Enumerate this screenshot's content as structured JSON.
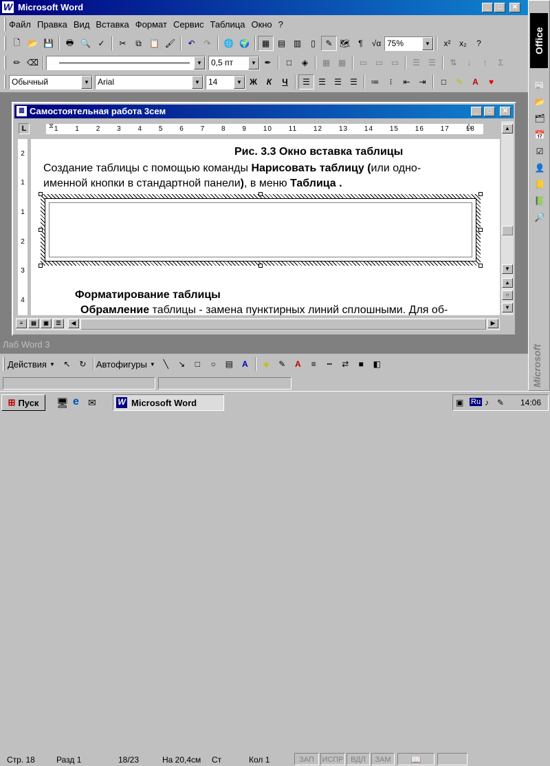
{
  "app": {
    "title": "Microsoft Word",
    "min": "_",
    "max": "□",
    "close": "✕"
  },
  "menu": [
    "Файл",
    "Правка",
    "Вид",
    "Вставка",
    "Формат",
    "Сервис",
    "Таблица",
    "Окно",
    "?"
  ],
  "toolbar": {
    "zoom": "75%",
    "border_width": "0,5 пт",
    "style": "Обычный",
    "font": "Arial",
    "size": "14",
    "bold": "Ж",
    "italic": "К",
    "underline": "Ч"
  },
  "doc": {
    "title": "Самостоятельная работа 3сем",
    "ruler": [
      "1",
      "1",
      "2",
      "3",
      "4",
      "5",
      "6",
      "7",
      "8",
      "9",
      "10",
      "11",
      "12",
      "13",
      "14",
      "15",
      "16",
      "17",
      "18"
    ],
    "vruler": [
      "2",
      "1",
      "1",
      "2",
      "3",
      "4"
    ],
    "caption": "Рис. 3.3  Окно вставка  таблицы",
    "l1a": "Создание таблицы  с помощью команды ",
    "l1b": "Нарисовать таблицу (",
    "l1c": "или одно-",
    "l2a": "именной кнопки в стандартной панели",
    "l2b": ")",
    "l2c": ", в меню ",
    "l2d": "Таблица .",
    "heading": "Форматирование  таблицы",
    "l3a": "Обрамление",
    "l3b": " таблицы - замена пунктирных линий сплошными. Для об-"
  },
  "side": {
    "office": "Office",
    "microsoft": "Microsoft"
  },
  "lab": "Лаб  Word 3",
  "draw": {
    "actions": "Действия",
    "autoshapes": "Автофигуры"
  },
  "status": {
    "page": "Стр. 18",
    "section": "Разд 1",
    "pages": "18/23",
    "at": "На 20,4см",
    "line": "Ст",
    "col": "Кол 1",
    "rec": "ЗАП",
    "trk": "ИСПР",
    "ext": "ВДЛ",
    "ovr": "ЗАМ"
  },
  "taskbar": {
    "start": "Пуск",
    "task": "Microsoft Word",
    "lang": "Ru",
    "time": "14:06"
  }
}
